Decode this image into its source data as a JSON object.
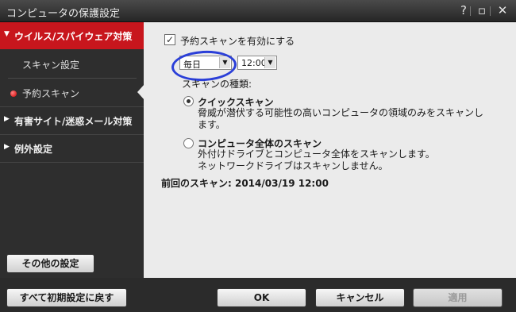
{
  "window": {
    "title": "コンピュータの保護設定",
    "help_glyph": "?",
    "minimize_glyph": "▫",
    "close_glyph": "✕"
  },
  "sidebar": {
    "active_section": "ウイルス/スパイウェア対策",
    "sub_items": [
      "スキャン設定",
      "予約スキャン"
    ],
    "groups": [
      "有害サイト/迷惑メール対策",
      "例外設定"
    ],
    "other_settings_button": "その他の設定"
  },
  "main": {
    "schedule_checkbox_label": "予約スキャンを有効にする",
    "schedule_checked_glyph": "✓",
    "frequency_value": "毎日",
    "time_value": "12:00",
    "dropdown_glyph": "▼",
    "scan_type_heading": "スキャンの種類:",
    "options": [
      {
        "label": "クイックスキャン",
        "desc_lines": [
          "脅威が潜伏する可能性の高いコンピュータの領域のみをスキャンし",
          "ます。"
        ]
      },
      {
        "label": "コンピュータ全体のスキャン",
        "desc_lines": [
          "外付けドライブとコンピュータ全体をスキャンします。",
          "ネットワークドライブはスキャンしません。"
        ]
      }
    ],
    "selected_option": "クイックスキャン",
    "last_scan": "前回のスキャン: 2014/03/19 12:00"
  },
  "footer": {
    "reset_button": "すべて初期設定に戻す",
    "ok_button": "OK",
    "cancel_button": "キャンセル",
    "apply_button": "適用"
  },
  "colors": {
    "accent_red": "#c8161d",
    "highlight_blue": "#2b3fd8",
    "panel_bg": "#ebebeb",
    "chrome_dark": "#2b2b2b"
  }
}
